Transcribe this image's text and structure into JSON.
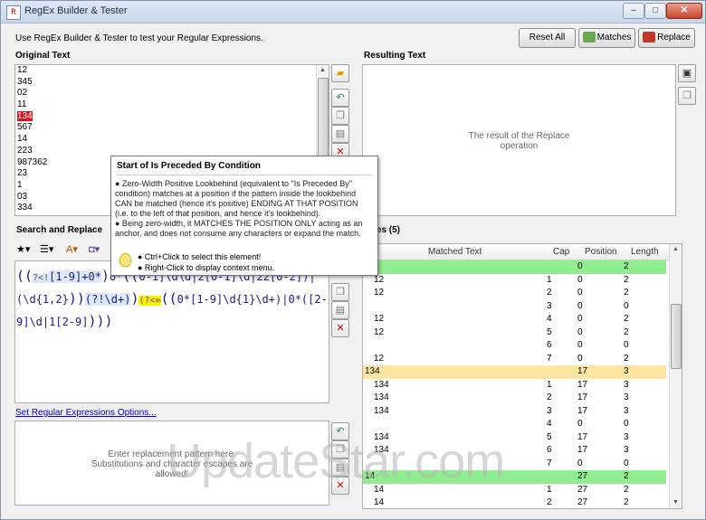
{
  "window": {
    "title": "RegEx Builder & Tester",
    "minimize": "–",
    "maximize": "□",
    "close": "✕"
  },
  "header": {
    "hint": "Use RegEx Builder & Tester to test your Regular Expressions.",
    "reset_label": "Reset All",
    "matches_label": "Matches",
    "replace_label": "Replace"
  },
  "original": {
    "label": "Original Text",
    "lines": [
      "12",
      "345",
      "02",
      "11",
      "134",
      "567",
      "14",
      "223",
      "987362",
      "23",
      "1",
      "03",
      "334"
    ],
    "highlight_index": 4
  },
  "result": {
    "label": "Resulting Text",
    "placeholder_line1": "The result of the Replace",
    "placeholder_line2": "operation"
  },
  "search": {
    "label": "Search and Replace"
  },
  "regex": {
    "p1": "((",
    "p2": "?<!",
    "p3": "[1-9]+0*",
    "p4": ")",
    "p5": "0*",
    "p6": "((",
    "p7": "0-1]\\d\\d|2[0-1]\\d|22[0-2]",
    "p8": ")|(\\d",
    "p9": "{1,2}",
    "p10": ")",
    "p11": ")",
    "p12": "(?!\\d+)",
    "p13": ")",
    "p14": "(?<=",
    "p15": "((",
    "p16": "0*[1-9]\\d{1}\\d+",
    "p17": ")|0*([2-9]\\d|1[2-",
    "p18": "9]",
    "p19": ")))"
  },
  "options_link": "Set Regular Expressions Options...",
  "replace_box": {
    "line1": "Enter replacement pattern here.",
    "line2": "Substitutions and character escapes are",
    "line3": "allowed!"
  },
  "matches": {
    "label": "Matches (5)",
    "columns": [
      "Matched Text",
      "Cap",
      "Position",
      "Length"
    ],
    "rows": [
      {
        "text": "",
        "cap": "",
        "pos": "0",
        "len": "2",
        "style": "green"
      },
      {
        "text": "12",
        "cap": "1",
        "pos": "0",
        "len": "2",
        "style": ""
      },
      {
        "text": "12",
        "cap": "2",
        "pos": "0",
        "len": "2",
        "style": ""
      },
      {
        "text": "",
        "cap": "3",
        "pos": "0",
        "len": "0",
        "style": ""
      },
      {
        "text": "12",
        "cap": "4",
        "pos": "0",
        "len": "2",
        "style": ""
      },
      {
        "text": "12",
        "cap": "5",
        "pos": "0",
        "len": "2",
        "style": ""
      },
      {
        "text": "",
        "cap": "6",
        "pos": "0",
        "len": "0",
        "style": ""
      },
      {
        "text": "12",
        "cap": "7",
        "pos": "0",
        "len": "2",
        "style": ""
      },
      {
        "text": "134",
        "cap": "",
        "pos": "17",
        "len": "3",
        "style": "yellow"
      },
      {
        "text": "134",
        "cap": "1",
        "pos": "17",
        "len": "3",
        "style": ""
      },
      {
        "text": "134",
        "cap": "2",
        "pos": "17",
        "len": "3",
        "style": ""
      },
      {
        "text": "134",
        "cap": "3",
        "pos": "17",
        "len": "3",
        "style": ""
      },
      {
        "text": "",
        "cap": "4",
        "pos": "0",
        "len": "0",
        "style": ""
      },
      {
        "text": "134",
        "cap": "5",
        "pos": "17",
        "len": "3",
        "style": ""
      },
      {
        "text": "134",
        "cap": "6",
        "pos": "17",
        "len": "3",
        "style": ""
      },
      {
        "text": "",
        "cap": "7",
        "pos": "0",
        "len": "0",
        "style": ""
      },
      {
        "text": "14",
        "cap": "",
        "pos": "27",
        "len": "2",
        "style": "green"
      },
      {
        "text": "14",
        "cap": "1",
        "pos": "27",
        "len": "2",
        "style": ""
      },
      {
        "text": "14",
        "cap": "2",
        "pos": "27",
        "len": "2",
        "style": ""
      }
    ]
  },
  "tooltip": {
    "title": "Start of Is Preceded By Condition",
    "line1": "● Zero-Width Positive Lookbehind (equivalent to \"Is Preceded By\"",
    "line2": "condition) matches at a position if the pattern inside the lookbehind",
    "line3": "CAN be matched (hence it's positive) ENDING AT THAT POSITION",
    "line4": "(i.e. to the left of that position, and hence it's lookbehind).",
    "line5": "● Being zero-width, it MATCHES THE POSITION ONLY acting as an",
    "line6": "anchor, and does not consume any characters or expand the match.",
    "foot1": "● Ctrl+Click to select this element!",
    "foot2": "● Right-Click to display context menu."
  },
  "watermark": "UpdateStar.com",
  "colors": {
    "highlight_red": "#d8161b",
    "match_green": "#90ee90",
    "match_yellow": "#fde7a0",
    "regex_yellow": "#ffee00"
  }
}
